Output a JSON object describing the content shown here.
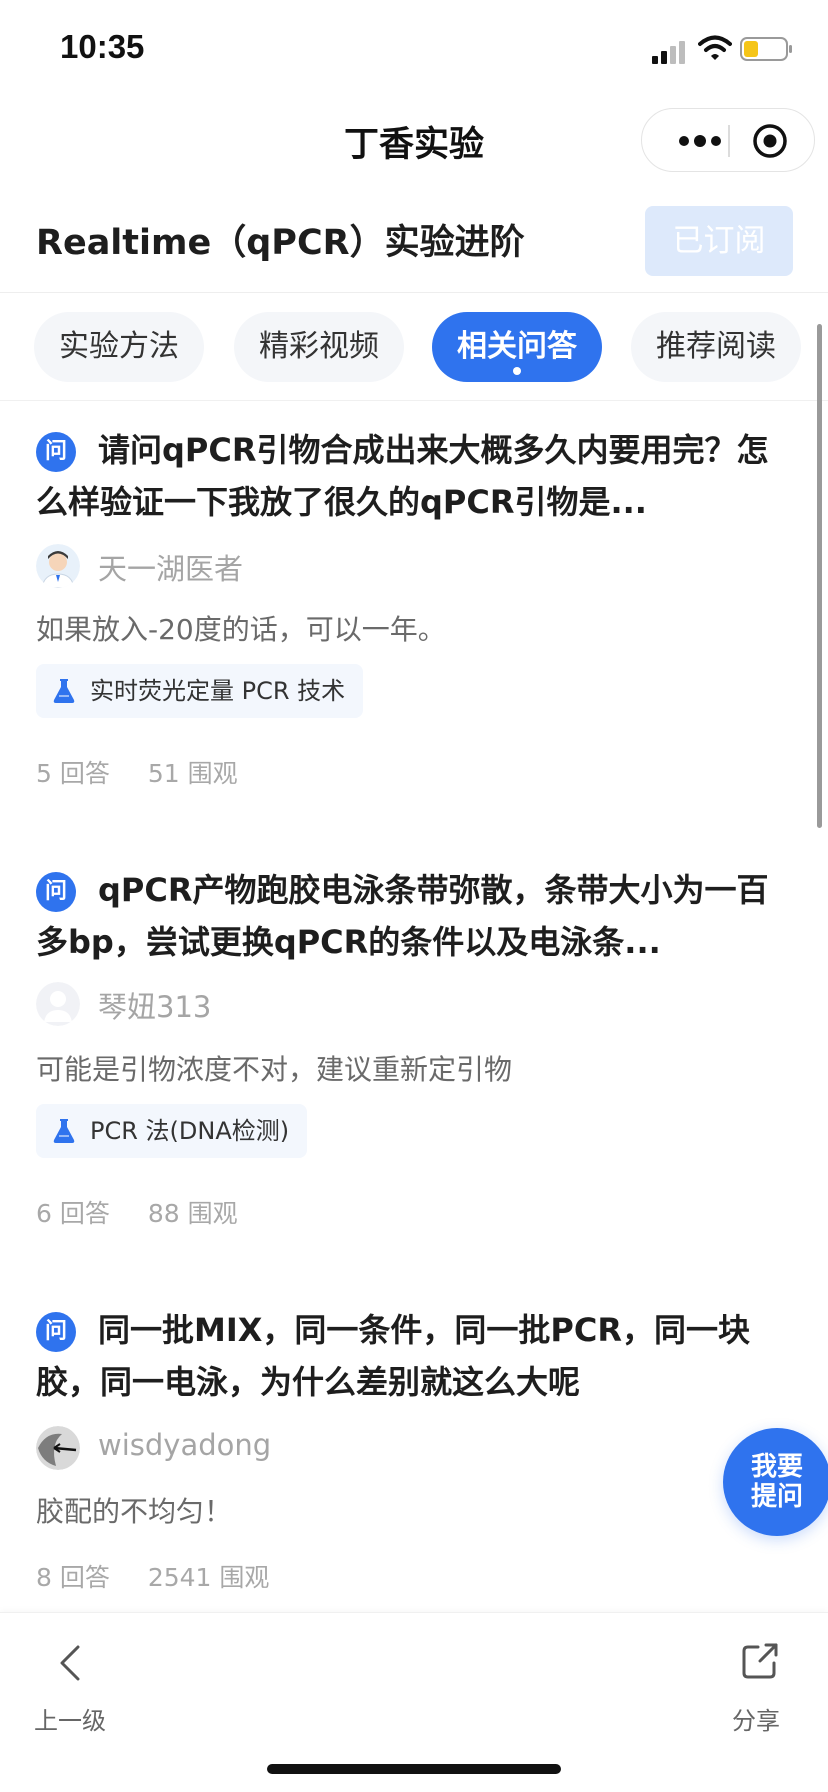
{
  "status_bar": {
    "time": "10:35"
  },
  "nav": {
    "title": "丁香实验"
  },
  "header": {
    "course_title": "Realtime（qPCR）实验进阶",
    "subscribe_label": "已订阅"
  },
  "tabs": [
    {
      "label": "实验方法"
    },
    {
      "label": "精彩视频"
    },
    {
      "label": "相关问答",
      "active": true
    },
    {
      "label": "推荐阅读"
    }
  ],
  "questions": [
    {
      "badge": "问",
      "title": "请问qPCR引物合成出来大概多久内要用完？怎么样验证一下我放了很久的qPCR引物是...",
      "author": "天一湖医者",
      "answer": "如果放入-20度的话，可以一年。",
      "tag": "实时荧光定量 PCR 技术",
      "answers_count": "5 回答",
      "views_count": "51 围观"
    },
    {
      "badge": "问",
      "title": "qPCR产物跑胶电泳条带弥散，条带大小为一百多bp，尝试更换qPCR的条件以及电泳条...",
      "author": "琴妞313",
      "answer": "可能是引物浓度不对，建议重新定引物",
      "tag": "PCR 法(DNA检测)",
      "answers_count": "6 回答",
      "views_count": "88 围观"
    },
    {
      "badge": "问",
      "title": "同一批MIX，同一条件，同一批PCR，同一块胶，同一电泳，为什么差别就这么大呢",
      "author": "wisdyadong",
      "answer": "胶配的不均匀！",
      "answers_count": "8 回答",
      "views_count": "2541 围观"
    }
  ],
  "fab": {
    "line1": "我要",
    "line2": "提问"
  },
  "bottom_bar": {
    "back_label": "上一级",
    "share_label": "分享"
  },
  "colors": {
    "accent": "#2f73ee",
    "subscribe_bg": "#dde9fb",
    "tag_bg": "#f3f7fd"
  }
}
